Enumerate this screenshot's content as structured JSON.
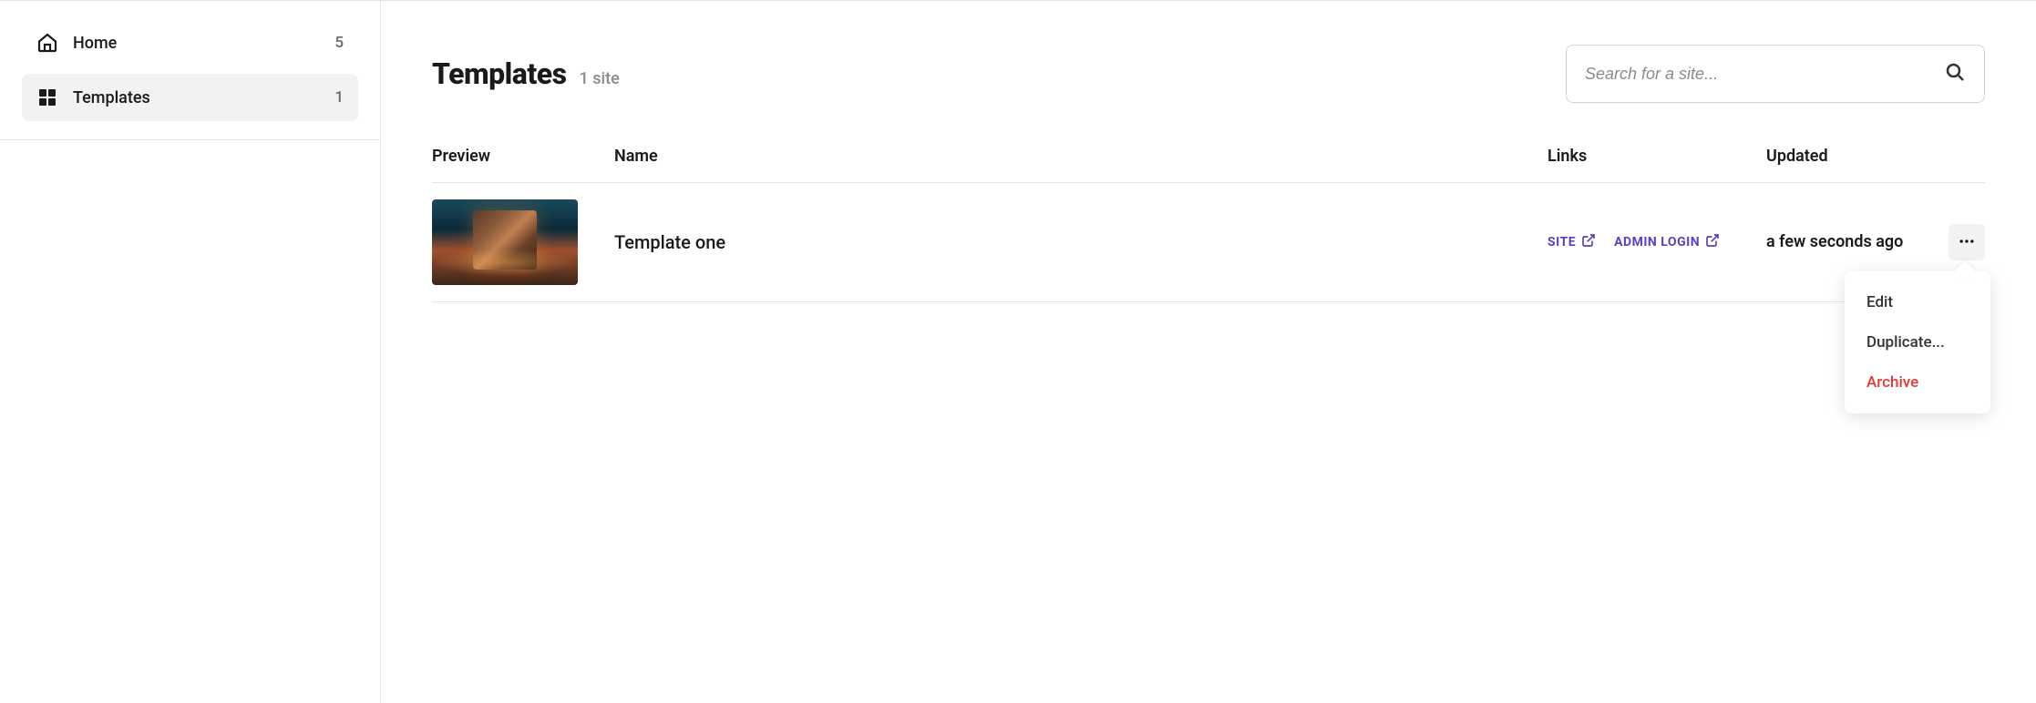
{
  "sidebar": {
    "items": [
      {
        "label": "Home",
        "count": "5",
        "icon": "home-icon",
        "active": false
      },
      {
        "label": "Templates",
        "count": "1",
        "icon": "grid-icon",
        "active": true
      }
    ]
  },
  "page": {
    "title": "Templates",
    "subtitle": "1 site"
  },
  "search": {
    "placeholder": "Search for a site..."
  },
  "table": {
    "columns": {
      "preview": "Preview",
      "name": "Name",
      "links": "Links",
      "updated": "Updated"
    },
    "rows": [
      {
        "name": "Template one",
        "links": {
          "site": "SITE",
          "admin": "ADMIN LOGIN"
        },
        "updated": "a few seconds ago"
      }
    ]
  },
  "dropdown": {
    "edit": "Edit",
    "duplicate": "Duplicate...",
    "archive": "Archive"
  },
  "colors": {
    "link": "#5a3ec8",
    "danger": "#e53935",
    "muted": "#8a8a8a"
  }
}
